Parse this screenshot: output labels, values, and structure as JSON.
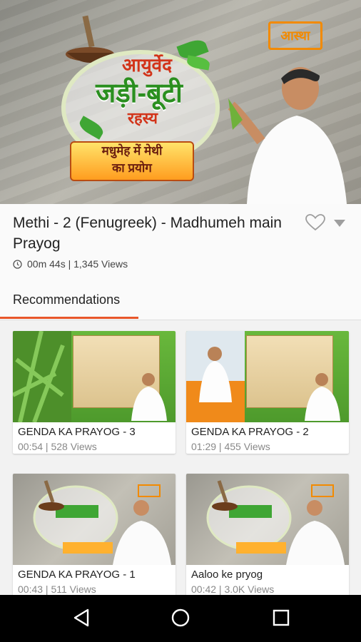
{
  "hero": {
    "brand": "आस्था",
    "title_line1": "आयुर्वेद",
    "title_line2": "जड़ी-बूटी",
    "title_line3": "रहस्य",
    "banner_line1": "मधुमेह में मेथी",
    "banner_line2": "का प्रयोग"
  },
  "video": {
    "title": "Methi - 2 (Fenugreek) - Madhumeh main Prayog",
    "duration": "00m 44s",
    "views": "1,345 Views",
    "stats": "00m 44s | 1,345 Views"
  },
  "tabs": {
    "active": "Recommendations"
  },
  "recommendations": [
    {
      "title": "GENDA KA PRAYOG - 3",
      "meta": "00:54 | 528 Views"
    },
    {
      "title": "GENDA KA PRAYOG - 2",
      "meta": "01:29 | 455 Views"
    },
    {
      "title": "GENDA KA PRAYOG - 1",
      "meta": "00:43 | 511 Views"
    },
    {
      "title": "Aaloo ke pryog",
      "meta": "00:42 | 3.0K Views"
    }
  ],
  "colors": {
    "accent": "#e8562a",
    "brand_orange": "#f28a00",
    "leaf_green": "#3fa634"
  },
  "icons": [
    "heart-icon",
    "dropdown-caret-icon",
    "clock-icon",
    "back-icon",
    "home-icon",
    "recents-icon"
  ]
}
